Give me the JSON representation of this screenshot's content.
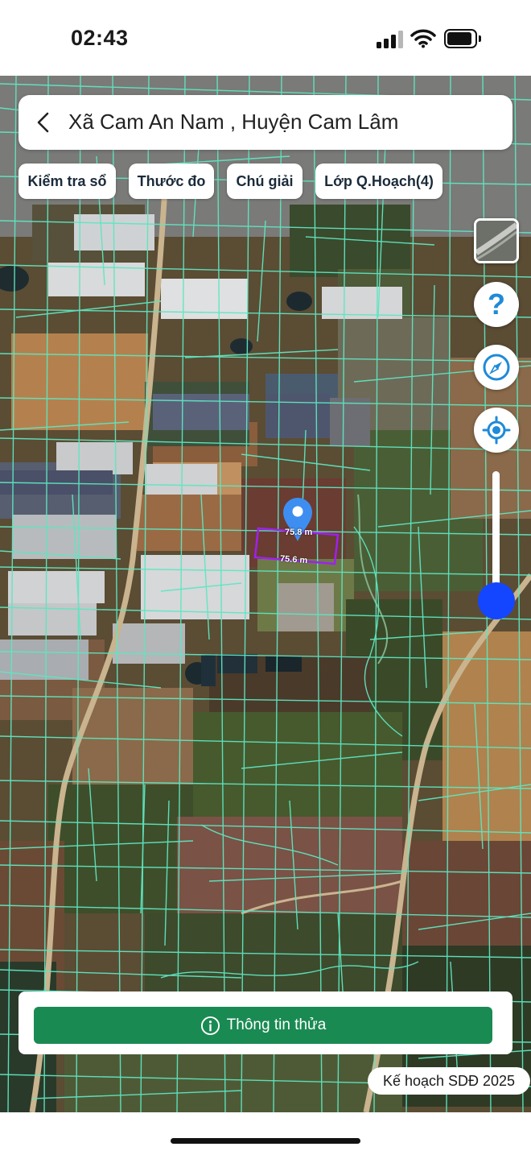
{
  "status_bar": {
    "time": "02:43"
  },
  "search": {
    "title": "Xã Cam An Nam , Huyện Cam Lâm",
    "back_icon": "chevron-left-icon"
  },
  "chips": [
    {
      "label": "Kiểm tra sổ"
    },
    {
      "label": "Thước đo"
    },
    {
      "label": "Chú giải"
    },
    {
      "label": "Lớp Q.Hoạch(4)"
    }
  ],
  "map_controls": {
    "layer_icon": "satellite-layer-icon",
    "help_icon": "question-icon",
    "compass_icon": "compass-icon",
    "locate_icon": "crosshair-icon",
    "zoom_level": 0.1
  },
  "measurements": {
    "top_edge": "75.8 m",
    "bottom_edge": "75.6 m"
  },
  "bottom": {
    "info_button_label": "Thông tin thửa",
    "info_icon": "info-circle-icon",
    "plan_badge": "Kế hoạch SDĐ 2025"
  },
  "colors": {
    "accent_green": "#1a8a53",
    "parcel_lines": "#5fe6c0",
    "selected_parcel": "#a020f0",
    "zoom_thumb": "#1446ff",
    "pin": "#3d8ef0"
  }
}
